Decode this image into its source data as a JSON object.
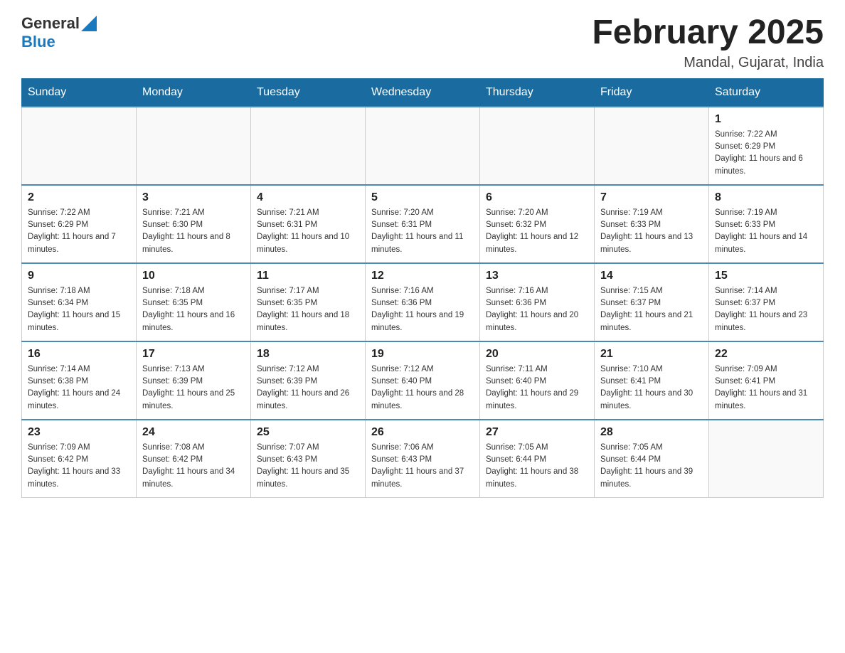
{
  "header": {
    "logo": {
      "general": "General",
      "blue": "Blue"
    },
    "title": "February 2025",
    "subtitle": "Mandal, Gujarat, India"
  },
  "days_of_week": [
    "Sunday",
    "Monday",
    "Tuesday",
    "Wednesday",
    "Thursday",
    "Friday",
    "Saturday"
  ],
  "weeks": [
    [
      {
        "day": "",
        "sunrise": "",
        "sunset": "",
        "daylight": ""
      },
      {
        "day": "",
        "sunrise": "",
        "sunset": "",
        "daylight": ""
      },
      {
        "day": "",
        "sunrise": "",
        "sunset": "",
        "daylight": ""
      },
      {
        "day": "",
        "sunrise": "",
        "sunset": "",
        "daylight": ""
      },
      {
        "day": "",
        "sunrise": "",
        "sunset": "",
        "daylight": ""
      },
      {
        "day": "",
        "sunrise": "",
        "sunset": "",
        "daylight": ""
      },
      {
        "day": "1",
        "sunrise": "Sunrise: 7:22 AM",
        "sunset": "Sunset: 6:29 PM",
        "daylight": "Daylight: 11 hours and 6 minutes."
      }
    ],
    [
      {
        "day": "2",
        "sunrise": "Sunrise: 7:22 AM",
        "sunset": "Sunset: 6:29 PM",
        "daylight": "Daylight: 11 hours and 7 minutes."
      },
      {
        "day": "3",
        "sunrise": "Sunrise: 7:21 AM",
        "sunset": "Sunset: 6:30 PM",
        "daylight": "Daylight: 11 hours and 8 minutes."
      },
      {
        "day": "4",
        "sunrise": "Sunrise: 7:21 AM",
        "sunset": "Sunset: 6:31 PM",
        "daylight": "Daylight: 11 hours and 10 minutes."
      },
      {
        "day": "5",
        "sunrise": "Sunrise: 7:20 AM",
        "sunset": "Sunset: 6:31 PM",
        "daylight": "Daylight: 11 hours and 11 minutes."
      },
      {
        "day": "6",
        "sunrise": "Sunrise: 7:20 AM",
        "sunset": "Sunset: 6:32 PM",
        "daylight": "Daylight: 11 hours and 12 minutes."
      },
      {
        "day": "7",
        "sunrise": "Sunrise: 7:19 AM",
        "sunset": "Sunset: 6:33 PM",
        "daylight": "Daylight: 11 hours and 13 minutes."
      },
      {
        "day": "8",
        "sunrise": "Sunrise: 7:19 AM",
        "sunset": "Sunset: 6:33 PM",
        "daylight": "Daylight: 11 hours and 14 minutes."
      }
    ],
    [
      {
        "day": "9",
        "sunrise": "Sunrise: 7:18 AM",
        "sunset": "Sunset: 6:34 PM",
        "daylight": "Daylight: 11 hours and 15 minutes."
      },
      {
        "day": "10",
        "sunrise": "Sunrise: 7:18 AM",
        "sunset": "Sunset: 6:35 PM",
        "daylight": "Daylight: 11 hours and 16 minutes."
      },
      {
        "day": "11",
        "sunrise": "Sunrise: 7:17 AM",
        "sunset": "Sunset: 6:35 PM",
        "daylight": "Daylight: 11 hours and 18 minutes."
      },
      {
        "day": "12",
        "sunrise": "Sunrise: 7:16 AM",
        "sunset": "Sunset: 6:36 PM",
        "daylight": "Daylight: 11 hours and 19 minutes."
      },
      {
        "day": "13",
        "sunrise": "Sunrise: 7:16 AM",
        "sunset": "Sunset: 6:36 PM",
        "daylight": "Daylight: 11 hours and 20 minutes."
      },
      {
        "day": "14",
        "sunrise": "Sunrise: 7:15 AM",
        "sunset": "Sunset: 6:37 PM",
        "daylight": "Daylight: 11 hours and 21 minutes."
      },
      {
        "day": "15",
        "sunrise": "Sunrise: 7:14 AM",
        "sunset": "Sunset: 6:37 PM",
        "daylight": "Daylight: 11 hours and 23 minutes."
      }
    ],
    [
      {
        "day": "16",
        "sunrise": "Sunrise: 7:14 AM",
        "sunset": "Sunset: 6:38 PM",
        "daylight": "Daylight: 11 hours and 24 minutes."
      },
      {
        "day": "17",
        "sunrise": "Sunrise: 7:13 AM",
        "sunset": "Sunset: 6:39 PM",
        "daylight": "Daylight: 11 hours and 25 minutes."
      },
      {
        "day": "18",
        "sunrise": "Sunrise: 7:12 AM",
        "sunset": "Sunset: 6:39 PM",
        "daylight": "Daylight: 11 hours and 26 minutes."
      },
      {
        "day": "19",
        "sunrise": "Sunrise: 7:12 AM",
        "sunset": "Sunset: 6:40 PM",
        "daylight": "Daylight: 11 hours and 28 minutes."
      },
      {
        "day": "20",
        "sunrise": "Sunrise: 7:11 AM",
        "sunset": "Sunset: 6:40 PM",
        "daylight": "Daylight: 11 hours and 29 minutes."
      },
      {
        "day": "21",
        "sunrise": "Sunrise: 7:10 AM",
        "sunset": "Sunset: 6:41 PM",
        "daylight": "Daylight: 11 hours and 30 minutes."
      },
      {
        "day": "22",
        "sunrise": "Sunrise: 7:09 AM",
        "sunset": "Sunset: 6:41 PM",
        "daylight": "Daylight: 11 hours and 31 minutes."
      }
    ],
    [
      {
        "day": "23",
        "sunrise": "Sunrise: 7:09 AM",
        "sunset": "Sunset: 6:42 PM",
        "daylight": "Daylight: 11 hours and 33 minutes."
      },
      {
        "day": "24",
        "sunrise": "Sunrise: 7:08 AM",
        "sunset": "Sunset: 6:42 PM",
        "daylight": "Daylight: 11 hours and 34 minutes."
      },
      {
        "day": "25",
        "sunrise": "Sunrise: 7:07 AM",
        "sunset": "Sunset: 6:43 PM",
        "daylight": "Daylight: 11 hours and 35 minutes."
      },
      {
        "day": "26",
        "sunrise": "Sunrise: 7:06 AM",
        "sunset": "Sunset: 6:43 PM",
        "daylight": "Daylight: 11 hours and 37 minutes."
      },
      {
        "day": "27",
        "sunrise": "Sunrise: 7:05 AM",
        "sunset": "Sunset: 6:44 PM",
        "daylight": "Daylight: 11 hours and 38 minutes."
      },
      {
        "day": "28",
        "sunrise": "Sunrise: 7:05 AM",
        "sunset": "Sunset: 6:44 PM",
        "daylight": "Daylight: 11 hours and 39 minutes."
      },
      {
        "day": "",
        "sunrise": "",
        "sunset": "",
        "daylight": ""
      }
    ]
  ]
}
